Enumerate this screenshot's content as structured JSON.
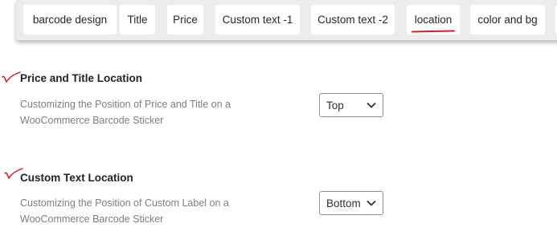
{
  "tabs": [
    {
      "label": "barcode design",
      "active": false
    },
    {
      "label": "Title",
      "active": false
    },
    {
      "label": "Price",
      "active": false
    },
    {
      "label": "Custom text -1",
      "active": false
    },
    {
      "label": "Custom text -2",
      "active": false
    },
    {
      "label": "location",
      "active": true
    },
    {
      "label": "color and bg",
      "active": false
    }
  ],
  "sections": [
    {
      "title": "Price and Title Location",
      "description": "Customizing the Position of Price and Title on a WooCommerce Barcode Sticker",
      "select_value": "Top"
    },
    {
      "title": "Custom Text Location",
      "description": "Customizing the Position of Custom Label on a WooCommerce Barcode Sticker",
      "select_value": "Bottom"
    }
  ],
  "colors": {
    "tabbar_bg": "#ececec",
    "active_underline": "#e01b22",
    "checkmark": "#d0131b",
    "description_text": "#7a7f84"
  },
  "icons": {
    "checkmark": "checkmark-annotation-icon",
    "dropdown": "chevron-down-icon"
  }
}
